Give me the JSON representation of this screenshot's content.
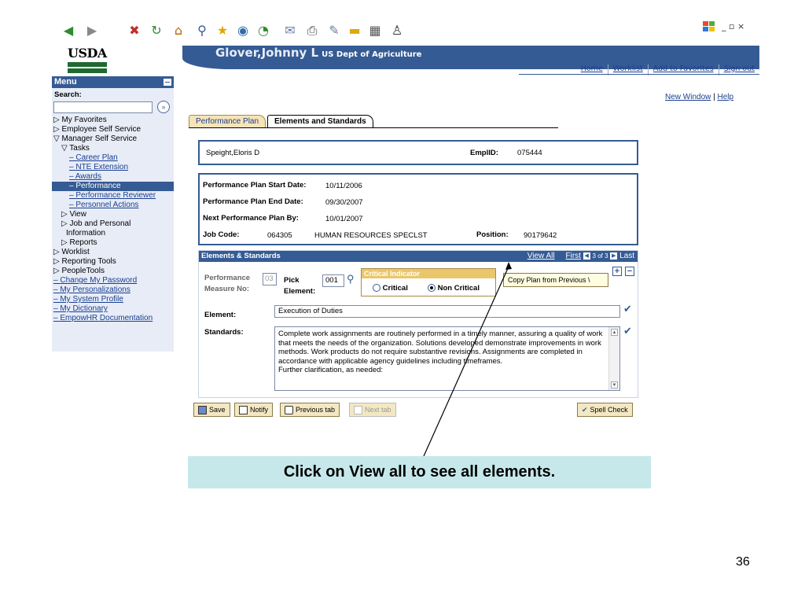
{
  "browser": {
    "toolbar_icons": [
      "back-icon",
      "forward-icon",
      "stop-icon",
      "refresh-icon",
      "home-icon",
      "search-icon",
      "favorites-icon",
      "media-icon",
      "history-icon",
      "mail-icon",
      "print-icon",
      "edit-icon",
      "folder-icon",
      "research-icon",
      "messenger-icon"
    ],
    "window_controls": "_ ▫ ×"
  },
  "header": {
    "logo_text": "USDA",
    "user_name": "Glover,Johnny L",
    "organization": "US Dept of Agriculture",
    "links": [
      "Home",
      "Worklist",
      "Add to Favorites",
      "Sign out"
    ]
  },
  "menu": {
    "title": "Menu",
    "search_label": "Search:",
    "items": [
      {
        "label": "▷ My Favorites",
        "type": "folder"
      },
      {
        "label": "▷ Employee Self Service",
        "type": "folder"
      },
      {
        "label": "▽ Manager Self Service",
        "type": "folder"
      },
      {
        "label": "▽ Tasks",
        "type": "folder",
        "indent": 1
      },
      {
        "label": "Career Plan",
        "type": "link",
        "indent": 2
      },
      {
        "label": "NTE Extension",
        "type": "link",
        "indent": 2
      },
      {
        "label": "Awards",
        "type": "link",
        "indent": 2
      },
      {
        "label": "Performance",
        "type": "selected",
        "indent": 2
      },
      {
        "label": "Performance Reviewer",
        "type": "link",
        "indent": 2
      },
      {
        "label": "Personnel Actions",
        "type": "link",
        "indent": 2
      },
      {
        "label": "▷ View",
        "type": "folder",
        "indent": 1
      },
      {
        "label": "▷ Job and Personal",
        "type": "folder",
        "indent": 1
      },
      {
        "label": "Information",
        "type": "folder",
        "indent": 1.6
      },
      {
        "label": "▷ Reports",
        "type": "folder",
        "indent": 1
      },
      {
        "label": "▷ Worklist",
        "type": "folder"
      },
      {
        "label": "▷ Reporting Tools",
        "type": "folder"
      },
      {
        "label": "▷ PeopleTools",
        "type": "folder"
      },
      {
        "label": "Change My Password",
        "type": "link",
        "indent": 0
      },
      {
        "label": "My Personalizations",
        "type": "link",
        "indent": 0
      },
      {
        "label": "My System Profile",
        "type": "link",
        "indent": 0
      },
      {
        "label": "My Dictionary",
        "type": "link",
        "indent": 0
      },
      {
        "label": "EmpowHR Documentation",
        "type": "link",
        "indent": 0
      }
    ]
  },
  "right_links": {
    "new_window": "New Window",
    "help": "Help"
  },
  "tabs": [
    {
      "label": "Performance Plan",
      "active": false
    },
    {
      "label": "Elements and Standards",
      "active": true
    }
  ],
  "employee": {
    "name": "Speight,Eloris D",
    "emplid_label": "EmplID:",
    "emplid": "075444"
  },
  "plan": {
    "start_label": "Performance Plan Start Date:",
    "start": "10/11/2006",
    "end_label": "Performance Plan End Date:",
    "end": "09/30/2007",
    "next_label": "Next Performance Plan By:",
    "next": "10/01/2007",
    "job_label": "Job Code:",
    "job_code": "064305",
    "job_title": "HUMAN RESOURCES SPECLST",
    "position_label": "Position:",
    "position": "90179642"
  },
  "elements": {
    "header": "Elements & Standards",
    "view_all": "View All",
    "first": "First",
    "counter": "3 of 3",
    "last": "Last",
    "measure_label_1": "Performance",
    "measure_label_2": "Measure No:",
    "measure_no": "03",
    "pick_label": "Pick",
    "element_sub_label": "Element:",
    "pick_value": "001",
    "critical_title": "Critical Indicator",
    "critical_option": "Critical",
    "noncritical_option": "Non Critical",
    "copy_button": "Copy Plan from Previous \\",
    "element_label": "Element:",
    "element_value": "Execution of Duties",
    "standards_label": "Standards:",
    "standards_text": "Complete work assignments are routinely performed in a timely manner, assuring a quality of work that meets the needs of the organization. Solutions developed demonstrate improvements in work methods. Work products do not require substantive revisions. Assignments are completed in accordance with applicable agency guidelines including timeframes.",
    "standards_more": "Further clarification, as needed:"
  },
  "buttons": {
    "save": "Save",
    "notify": "Notify",
    "previous_tab": "Previous tab",
    "next_tab": "Next tab",
    "spell_check": "Spell Check"
  },
  "callout": "Click on View all to see all elements.",
  "page_number": "36"
}
